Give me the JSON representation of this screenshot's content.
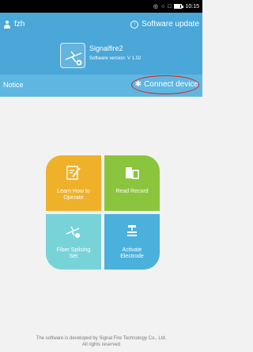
{
  "status_bar": {
    "time": "10:15",
    "icons": [
      "wifi-icon",
      "sync-icon",
      "battery-icon"
    ]
  },
  "header": {
    "username": "fzh",
    "software_update_label": "Software update",
    "app_name": "Signalfire2",
    "software_version": "Software version: V 1.02"
  },
  "notice_bar": {
    "notice_label": "Notice",
    "connect_device_label": "Connect device"
  },
  "menu": {
    "tiles": [
      {
        "label_line1": "Learn How to",
        "label_line2": "Operate",
        "icon": "edit-icon",
        "color": "#f0b12a"
      },
      {
        "label_line1": "Read Record",
        "label_line2": "",
        "icon": "record-icon",
        "color": "#8bc43d"
      },
      {
        "label_line1": "Fiber Splicing",
        "label_line2": "Set",
        "icon": "fiber-splicing-icon",
        "color": "#78d3d9"
      },
      {
        "label_line1": "Activate",
        "label_line2": "Electrode",
        "icon": "electrode-icon",
        "color": "#4bb1dc"
      }
    ]
  },
  "footer": {
    "line1": "The software is developed by Signal Fire Technology Co., Ltd.",
    "line2": "All rights reserved"
  },
  "colors": {
    "header_bg": "#4aa7d8",
    "notice_bg": "#5fb6e1",
    "highlight": "#e01e1e"
  }
}
